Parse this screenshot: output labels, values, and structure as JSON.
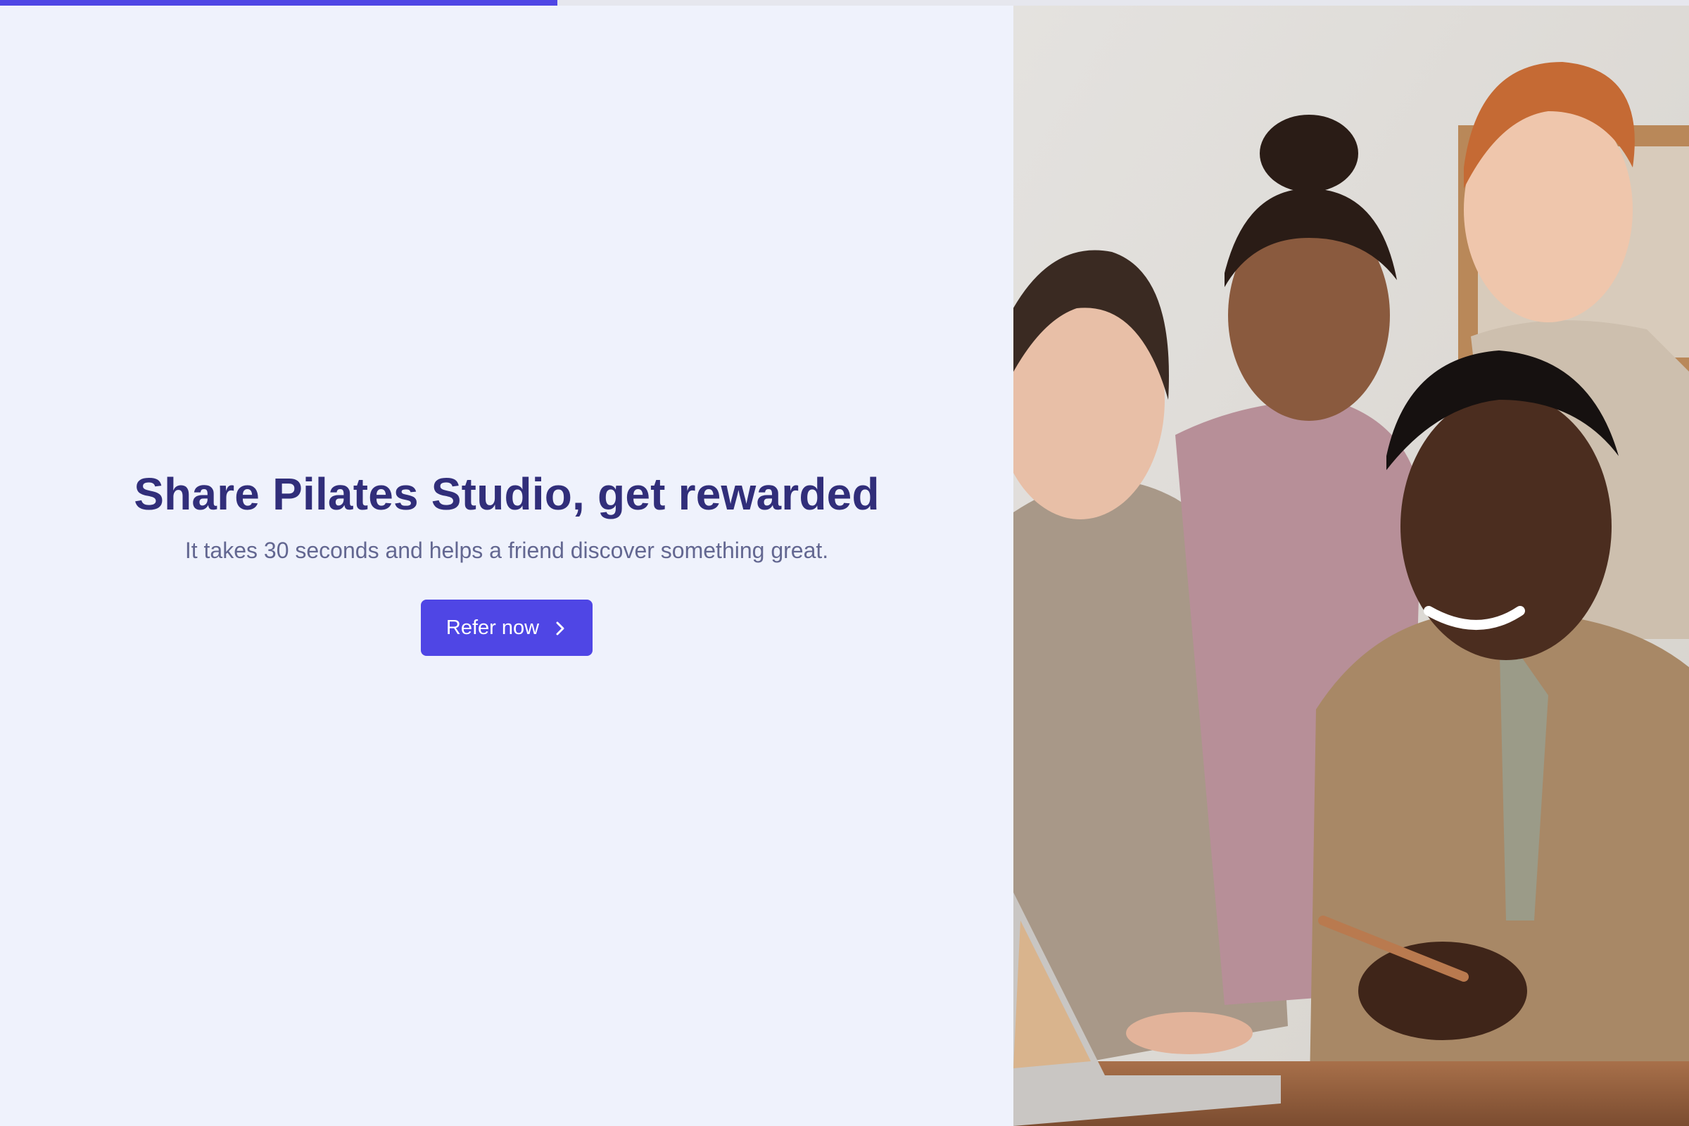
{
  "progress": {
    "fraction": 0.33
  },
  "hero": {
    "title": "Share Pilates Studio, get rewarded",
    "subtitle": "It takes 30 seconds and helps a friend discover something great.",
    "cta_label": "Refer now",
    "cta_icon": "chevron-right-icon"
  },
  "image": {
    "alt": "Four smiling colleagues gathered around a laptop"
  },
  "colors": {
    "accent": "#4f46e5",
    "heading": "#312e7a",
    "subtext": "#636791",
    "background": "#eff2fc"
  }
}
